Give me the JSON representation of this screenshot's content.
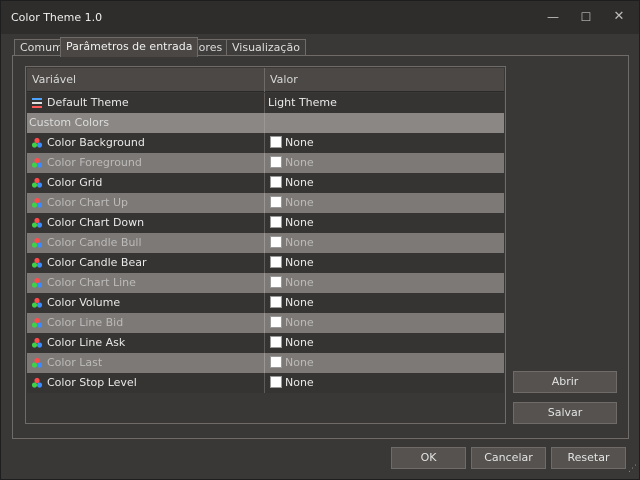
{
  "window": {
    "title": "Color Theme 1.0",
    "controls": {
      "minimize": "—",
      "maximize": "☐",
      "close": "✕"
    }
  },
  "tabs": [
    {
      "label": "Comum",
      "active": false
    },
    {
      "label": "Parâmetros de entrada",
      "active": true
    },
    {
      "label": "Cores",
      "active": false
    },
    {
      "label": "Visualização",
      "active": false
    }
  ],
  "grid": {
    "columns": {
      "variable": "Variável",
      "value": "Valor"
    },
    "default_theme": {
      "name": "Default Theme",
      "value": "Light Theme"
    },
    "section": {
      "name": "Custom Colors"
    },
    "rows": [
      {
        "name": "Color Background",
        "value": "None"
      },
      {
        "name": "Color Foreground",
        "value": "None"
      },
      {
        "name": "Color Grid",
        "value": "None"
      },
      {
        "name": "Color Chart Up",
        "value": "None"
      },
      {
        "name": "Color Chart Down",
        "value": "None"
      },
      {
        "name": "Color Candle Bull",
        "value": "None"
      },
      {
        "name": "Color Candle Bear",
        "value": "None"
      },
      {
        "name": "Color Chart Line",
        "value": "None"
      },
      {
        "name": "Color Volume",
        "value": "None"
      },
      {
        "name": "Color Line Bid",
        "value": "None"
      },
      {
        "name": "Color Line Ask",
        "value": "None"
      },
      {
        "name": "Color Last",
        "value": "None"
      },
      {
        "name": "Color Stop Level",
        "value": "None"
      }
    ]
  },
  "side_buttons": {
    "open": "Abrir",
    "save": "Salvar"
  },
  "footer": {
    "ok": "OK",
    "cancel": "Cancelar",
    "reset": "Resetar"
  },
  "colors": {
    "swatch": "#ffffff",
    "window_bg": "#3a3836",
    "row_light": "#7c7976",
    "row_dark": "#363432"
  }
}
